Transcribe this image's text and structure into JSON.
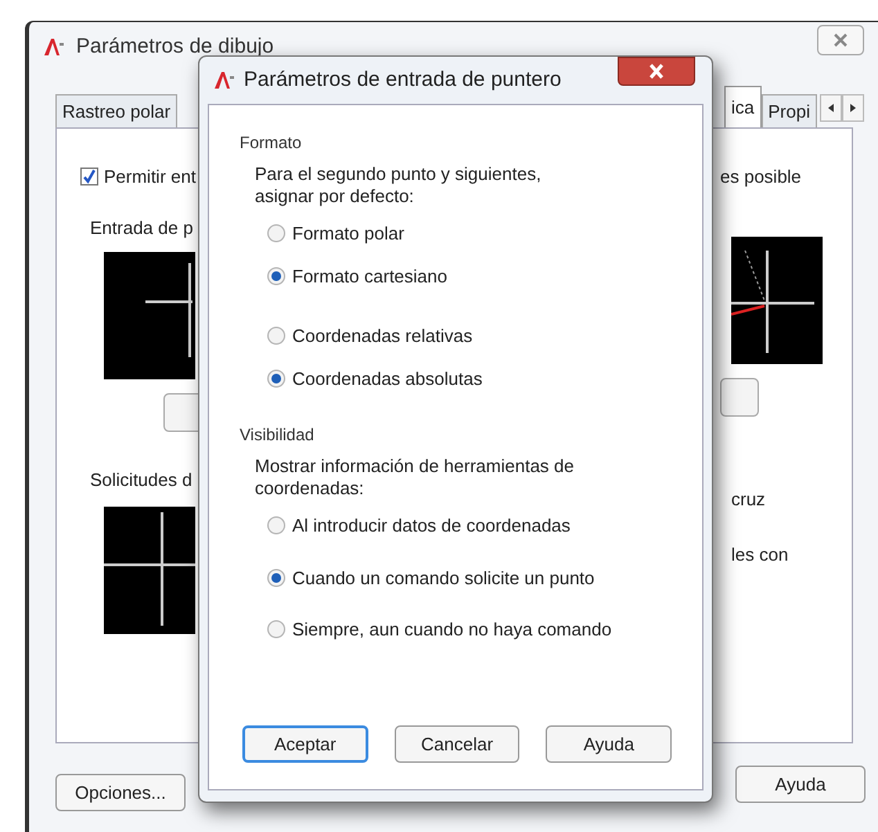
{
  "back_window": {
    "title": "Parámetros de dibujo",
    "tabs": [
      {
        "label": "Rastreo polar",
        "selected": false
      },
      {
        "label": "ica",
        "selected": true
      },
      {
        "label": "Propi",
        "selected": false
      }
    ],
    "left": {
      "checkbox": {
        "label": "Permitir ent",
        "checked": true
      },
      "group_1": "Entrada de p",
      "group_2": "Solicitudes d"
    },
    "right": {
      "text_1": "es posible",
      "text_2": "cruz",
      "text_3": "les con"
    },
    "buttons": [
      "Opciones...",
      "Ayuda"
    ]
  },
  "dialog": {
    "title": "Parámetros de entrada de puntero",
    "sections": [
      {
        "title": "Formato",
        "prompt": "Para el segundo punto y siguientes, asignar por defecto:",
        "option_groups": [
          [
            {
              "label": "Formato polar",
              "selected": false
            },
            {
              "label": "Formato cartesiano",
              "selected": true
            }
          ],
          [
            {
              "label": "Coordenadas relativas",
              "selected": false
            },
            {
              "label": "Coordenadas absolutas",
              "selected": true
            }
          ]
        ]
      },
      {
        "title": "Visibilidad",
        "prompt": "Mostrar información de herramientas de coordenadas:",
        "option_groups": [
          [
            {
              "label": "Al introducir datos de coordenadas",
              "selected": false
            },
            {
              "label": "Cuando un comando solicite un punto",
              "selected": true
            },
            {
              "label": "Siempre, aun cuando no haya comando",
              "selected": false
            }
          ]
        ]
      }
    ],
    "buttons": [
      {
        "label": "Aceptar",
        "default": true
      },
      {
        "label": "Cancelar",
        "default": false
      },
      {
        "label": "Ayuda",
        "default": false
      }
    ]
  }
}
